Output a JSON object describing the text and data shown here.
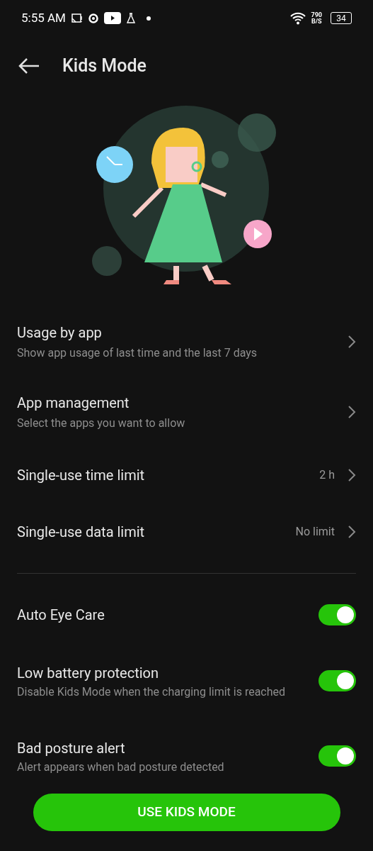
{
  "status_bar": {
    "time": "5:55 AM",
    "speed_value": "790",
    "speed_unit": "B/S",
    "battery": "34"
  },
  "header": {
    "title": "Kids Mode"
  },
  "nav_items": [
    {
      "title": "Usage by app",
      "subtitle": "Show app usage of last time and the last 7 days"
    },
    {
      "title": "App management",
      "subtitle": "Select the apps you want to allow"
    },
    {
      "title": "Single-use time limit",
      "value": "2 h"
    },
    {
      "title": "Single-use data limit",
      "value": "No limit"
    }
  ],
  "toggle_items": [
    {
      "title": "Auto Eye Care",
      "on": true
    },
    {
      "title": "Low battery protection",
      "subtitle": "Disable Kids Mode when the charging limit is reached",
      "on": true
    },
    {
      "title": "Bad posture alert",
      "subtitle": "Alert appears when bad posture detected",
      "on": true
    }
  ],
  "primary_button": "USE KIDS MODE"
}
